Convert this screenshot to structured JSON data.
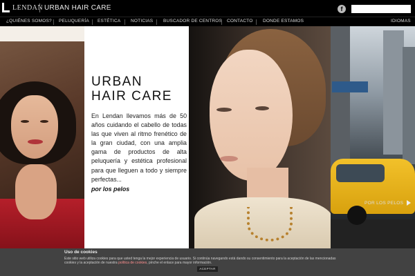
{
  "header": {
    "logo_text": "LENDAN",
    "brand": "URBAN HAIR CARE",
    "facebook_glyph": "f",
    "search": {
      "value": "",
      "placeholder": ""
    }
  },
  "nav": {
    "items": [
      "¿QUIÉNES SOMOS?",
      "PELUQUERÍA",
      "ESTÉTICA",
      "NOTICIAS",
      "BUSCADOR DE CENTROS",
      "CONTACTO",
      "DONDE ESTAMOS"
    ],
    "languages": "IDIOMAS"
  },
  "hero": {
    "title_line1": "URBAN",
    "title_line2": "HAIR CARE",
    "body": "En Lendan llevamos más de 50 años cuidando el cabello de todas las que viven al ritmo frenético de la gran ciudad, con una amplia gama de productos de alta peluquería y estética profesional para que lleguen a todo y siempre perfectas...",
    "tagline": "por los pelos",
    "caption": "POR LOS PELOS"
  },
  "cookies": {
    "title": "Uso de cookies",
    "text_before": "Este sitio web utiliza cookies para que usted tenga la mejor experiencia de usuario. Si continúa navegando está dando su consentimiento para la aceptación de las mencionadas cookies y la aceptación de nuestra ",
    "link": "política de cookies",
    "text_after": ", pinche el enlace para mayor información.",
    "accept": "ACEPTAR"
  },
  "colors": {
    "background": "#000000",
    "text_panel": "#ffffff",
    "cookie_bar": "#464646",
    "cookie_link": "#ff8f8f"
  },
  "icons": [
    "lendan-logo-icon",
    "facebook-icon",
    "slide-next-arrow-icon"
  ]
}
